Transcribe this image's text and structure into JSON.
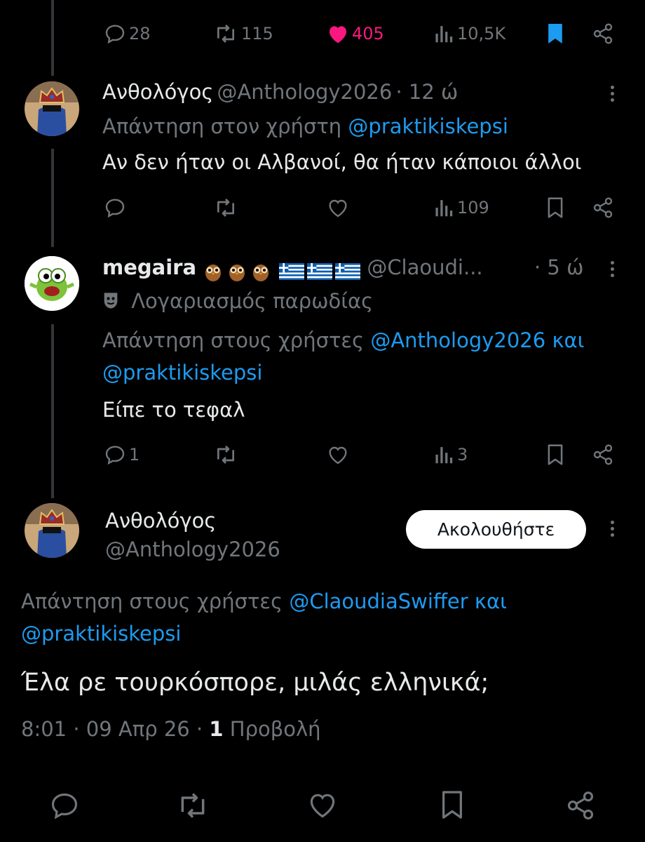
{
  "top_tweet_actions": {
    "replies": "28",
    "reposts": "115",
    "likes": "405",
    "views": "10,5K"
  },
  "reply1": {
    "display_name": "Ανθολόγος",
    "handle": "@Anthology2026",
    "time": "· 12 ώ",
    "reply_prefix": "Απάντηση στον χρήστη",
    "reply_to": "@praktikiskepsi",
    "text": "Αν δεν ήταν οι Αλβανοί, θα ήταν κάποιοι άλλοι",
    "views": "109"
  },
  "reply2": {
    "display_name": "megaira",
    "handle": "@Claoudi...",
    "time": "· 5 ώ",
    "parody_label": "Λογαριασμός παρωδίας",
    "reply_prefix": "Απάντηση στους χρήστες",
    "reply_to_1": "@Anthology2026",
    "reply_and": "και",
    "reply_to_2": "@praktikiskepsi",
    "text": "Είπε το τεφαλ",
    "replies": "1",
    "views": "3"
  },
  "main_tweet": {
    "display_name": "Ανθολόγος",
    "handle": "@Anthology2026",
    "follow_label": "Ακολουθήστε",
    "reply_prefix": "Απάντηση στους χρήστες",
    "reply_to_1": "@ClaoudiaSwiffer",
    "reply_and": "και",
    "reply_to_2": "@praktikiskepsi",
    "text": "Έλα ρε τουρκόσπορε, μιλάς ελληνικά;",
    "timestamp": "8:01 · 09 Απρ 26 ·",
    "view_count": "1",
    "view_label": "Προβολή"
  },
  "colors": {
    "background": "#000000",
    "link": "#1d9bf0",
    "like": "#f91880",
    "bookmark": "#1d9bf0",
    "muted": "#71767b"
  }
}
